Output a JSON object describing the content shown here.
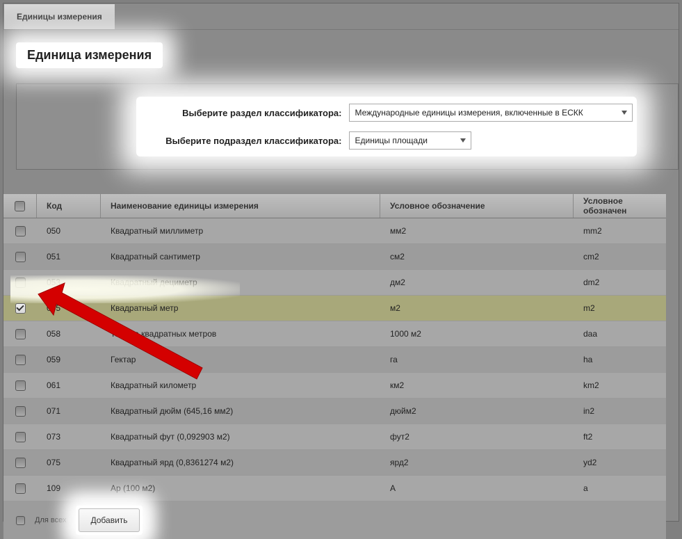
{
  "tab": {
    "label": "Единицы измерения"
  },
  "section": {
    "title": "Единица измерения"
  },
  "filter": {
    "section_label": "Выберите раздел классификатора:",
    "section_value": "Международные единицы измерения, включенные в ЕСКК",
    "subsection_label": "Выберите подраздел классификатора:",
    "subsection_value": "Единицы площади"
  },
  "table": {
    "headers": {
      "code": "Код",
      "name": "Наименование единицы измерения",
      "sym": "Условное обозначение",
      "sym2": "Условное обозначен"
    },
    "rows": [
      {
        "checked": false,
        "code": "050",
        "name": "Квадратный миллиметр",
        "sym": "мм2",
        "sym2": "mm2"
      },
      {
        "checked": false,
        "code": "051",
        "name": "Квадратный сантиметр",
        "sym": "см2",
        "sym2": "cm2"
      },
      {
        "checked": false,
        "code": "053",
        "name": "Квадратный дециметр",
        "sym": "дм2",
        "sym2": "dm2"
      },
      {
        "checked": true,
        "code": "055",
        "name": "Квадратный метр",
        "sym": "м2",
        "sym2": "m2"
      },
      {
        "checked": false,
        "code": "058",
        "name": "Тысяча квадратных метров",
        "sym": "1000 м2",
        "sym2": "daa"
      },
      {
        "checked": false,
        "code": "059",
        "name": "Гектар",
        "sym": "га",
        "sym2": "ha"
      },
      {
        "checked": false,
        "code": "061",
        "name": "Квадратный километр",
        "sym": "км2",
        "sym2": "km2"
      },
      {
        "checked": false,
        "code": "071",
        "name": "Квадратный дюйм (645,16 мм2)",
        "sym": "дюйм2",
        "sym2": "in2"
      },
      {
        "checked": false,
        "code": "073",
        "name": "Квадратный фут (0,092903 м2)",
        "sym": "фут2",
        "sym2": "ft2"
      },
      {
        "checked": false,
        "code": "075",
        "name": "Квадратный ярд (0,8361274 м2)",
        "sym": "ярд2",
        "sym2": "yd2"
      },
      {
        "checked": false,
        "code": "109",
        "name": "Ар (100 м2)",
        "sym": "А",
        "sym2": "a"
      }
    ]
  },
  "footer": {
    "all_label": "Для всех",
    "add_label": "Добавить"
  }
}
